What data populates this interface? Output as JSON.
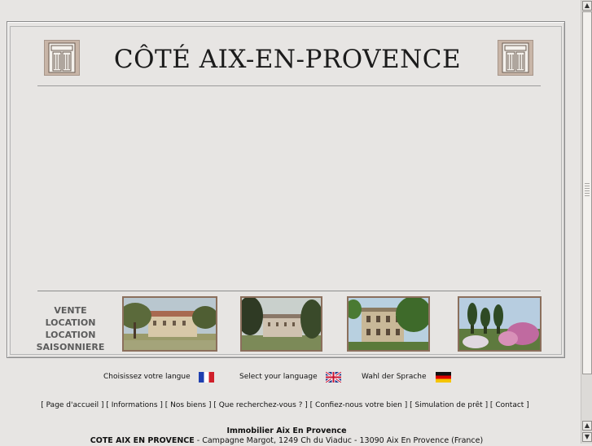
{
  "header": {
    "title": "CÔTÉ AIX-EN-PROVENCE"
  },
  "menu": {
    "items": [
      "VENTE",
      "LOCATION",
      "LOCATION SAISONNIERE"
    ]
  },
  "languages": [
    {
      "label": "Choisissez votre langue",
      "icon": "flag-france-icon"
    },
    {
      "label": "Select your language",
      "icon": "flag-uk-icon"
    },
    {
      "label": "Wahl der Sprache",
      "icon": "flag-germany-icon"
    }
  ],
  "nav_links": [
    "Page d'accueil",
    "Informations",
    "Nos biens",
    "Que recherchez-vous ?",
    "Confiez-nous votre bien",
    "Simulation de prêt",
    "Contact"
  ],
  "footer": {
    "line1": "Immobilier Aix En Provence",
    "company": "COTE AIX EN PROVENCE",
    "address": " - Campagne Margot, 1249 Ch du Viaduc - 13090 Aix En Provence (France)"
  },
  "colors": {
    "background": "#e7e5e3",
    "photo_border": "#8b6f5c",
    "logo_bg": "#c8b5a7",
    "menu_text": "#5c5c5c"
  }
}
